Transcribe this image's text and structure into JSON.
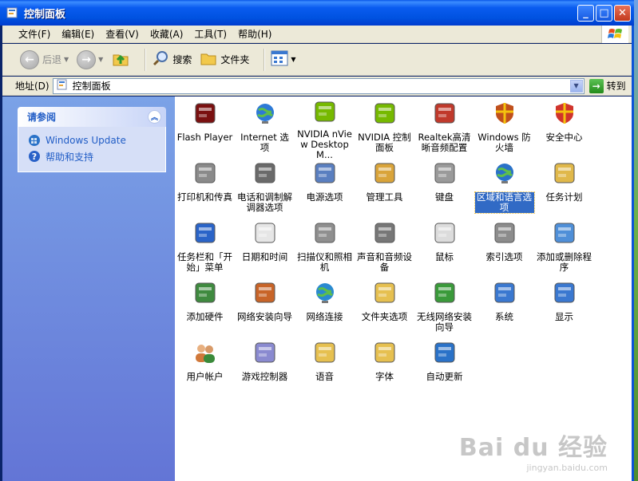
{
  "window": {
    "title": "控制面板",
    "buttons": {
      "minimize": "_",
      "maximize": "□",
      "close": "✕"
    }
  },
  "menu": [
    "文件(F)",
    "编辑(E)",
    "查看(V)",
    "收藏(A)",
    "工具(T)",
    "帮助(H)"
  ],
  "toolbar": {
    "back": "后退",
    "search": "搜索",
    "folders": "文件夹"
  },
  "address": {
    "label": "地址(D)",
    "value": "控制面板",
    "go": "转到"
  },
  "tasks": {
    "heading": "请参阅",
    "links": [
      "Windows Update",
      "帮助和支持"
    ]
  },
  "items": [
    {
      "label": "Flash Player",
      "icon": "flash-icon",
      "color": "#7a1010"
    },
    {
      "label": "Internet 选项",
      "icon": "globe-check-icon",
      "color": "#2d7ad6"
    },
    {
      "label": "NVIDIA nView Desktop M...",
      "icon": "nvidia-eye-icon",
      "color": "#76b900"
    },
    {
      "label": "NVIDIA 控制面板",
      "icon": "nvidia-panel-icon",
      "color": "#76b900"
    },
    {
      "label": "Realtek高清晰音频配置",
      "icon": "speaker-icon",
      "color": "#c0392b"
    },
    {
      "label": "Windows 防火墙",
      "icon": "firewall-icon",
      "color": "#c0501c"
    },
    {
      "label": "安全中心",
      "icon": "shield-icon",
      "color": "#d0342c"
    },
    {
      "label": "打印机和传真",
      "icon": "printer-icon",
      "color": "#8a8a8a"
    },
    {
      "label": "电话和调制解调器选项",
      "icon": "phone-icon",
      "color": "#6a6a6a"
    },
    {
      "label": "电源选项",
      "icon": "power-icon",
      "color": "#5a7fc0"
    },
    {
      "label": "管理工具",
      "icon": "admin-tools-icon",
      "color": "#d9a43a"
    },
    {
      "label": "键盘",
      "icon": "keyboard-icon",
      "color": "#9a9a9a"
    },
    {
      "label": "区域和语言选项",
      "icon": "globe-icon",
      "color": "#2a72c8",
      "selected": true
    },
    {
      "label": "任务计划",
      "icon": "scheduled-tasks-icon",
      "color": "#e0b84a"
    },
    {
      "label": "任务栏和「开始」菜单",
      "icon": "taskbar-icon",
      "color": "#2a64c8"
    },
    {
      "label": "日期和时间",
      "icon": "clock-icon",
      "color": "#e6e6e6"
    },
    {
      "label": "扫描仪和照相机",
      "icon": "scanner-icon",
      "color": "#8f8f8f"
    },
    {
      "label": "声音和音频设备",
      "icon": "sound-icon",
      "color": "#777777"
    },
    {
      "label": "鼠标",
      "icon": "mouse-icon",
      "color": "#dcdcdc"
    },
    {
      "label": "索引选项",
      "icon": "index-icon",
      "color": "#8c8c8c"
    },
    {
      "label": "添加或删除程序",
      "icon": "add-remove-icon",
      "color": "#4f8fd8"
    },
    {
      "label": "添加硬件",
      "icon": "hardware-icon",
      "color": "#3f8a3f"
    },
    {
      "label": "网络安装向导",
      "icon": "home-network-icon",
      "color": "#c86428"
    },
    {
      "label": "网络连接",
      "icon": "network-globe-icon",
      "color": "#2a8ad0"
    },
    {
      "label": "文件夹选项",
      "icon": "folder-check-icon",
      "color": "#e6c050"
    },
    {
      "label": "无线网络安装向导",
      "icon": "wireless-icon",
      "color": "#3a9a3a"
    },
    {
      "label": "系统",
      "icon": "system-icon",
      "color": "#3a78d0"
    },
    {
      "label": "显示",
      "icon": "display-icon",
      "color": "#3a78d0"
    },
    {
      "label": "用户帐户",
      "icon": "users-icon",
      "color": "#d0783a"
    },
    {
      "label": "游戏控制器",
      "icon": "gamepad-icon",
      "color": "#8a8ad0"
    },
    {
      "label": "语音",
      "icon": "speech-icon",
      "color": "#e6c050"
    },
    {
      "label": "字体",
      "icon": "fonts-icon",
      "color": "#e6c050"
    },
    {
      "label": "自动更新",
      "icon": "windows-update-icon",
      "color": "#2a72c8"
    }
  ],
  "watermark": {
    "line1": "Bai du 经验",
    "line2": "jingyan.baidu.com"
  }
}
